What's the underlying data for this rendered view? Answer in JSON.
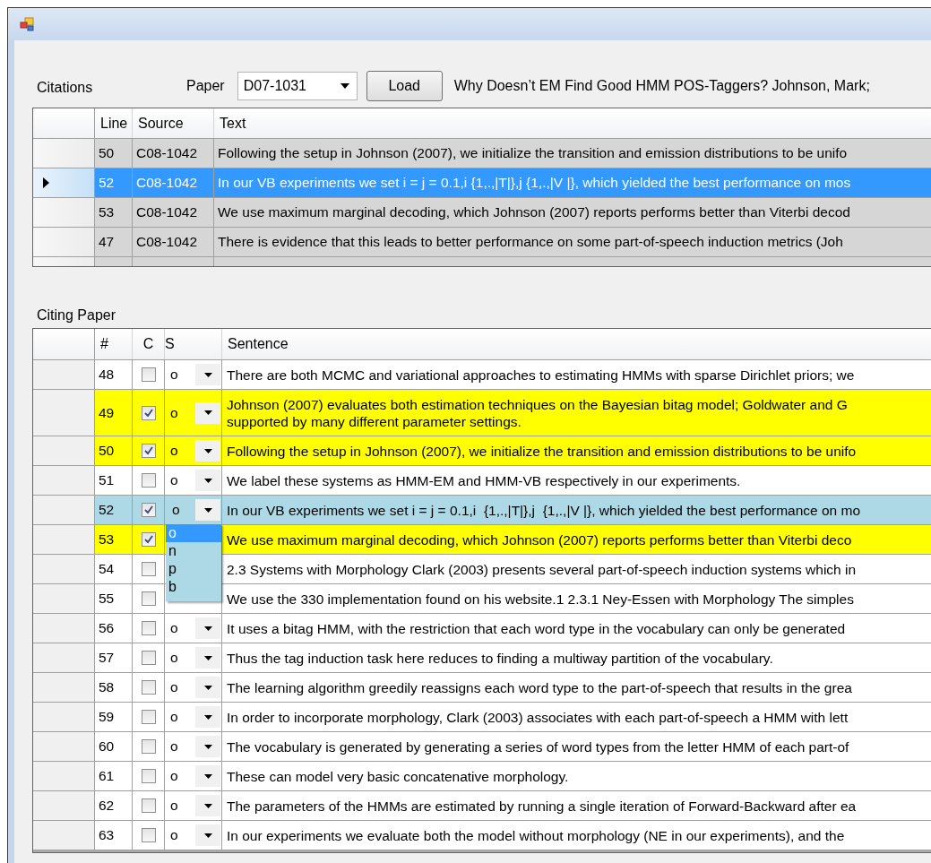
{
  "citations": {
    "label": "Citations",
    "paper_label": "Paper",
    "paper_value": "D07-1031",
    "load_button": "Load",
    "paper_title": "Why Doesn’t EM Find Good HMM POS-Taggers? Johnson, Mark;",
    "columns": [
      "Line",
      "Source",
      "Text"
    ],
    "rows": [
      {
        "line": "50",
        "source": "C08-1042",
        "text": "Following the setup in Johnson (2007), we initialize the transition and emission distributions to be unifo",
        "selected": false
      },
      {
        "line": "52",
        "source": "C08-1042",
        "text": "In our VB experiments we set i = j = 0.1,i  {1,.,|T|},j  {1,.,|V |}, which yielded the best performance on mos",
        "selected": true
      },
      {
        "line": "53",
        "source": "C08-1042",
        "text": "We use maximum marginal decoding, which Johnson (2007) reports performs better than Viterbi decod",
        "selected": false
      },
      {
        "line": "47",
        "source": "C08-1042",
        "text": "There is evidence that this leads to better performance on some part-of-speech induction metrics (Joh",
        "selected": false
      }
    ]
  },
  "citing_paper": {
    "label": "Citing Paper",
    "columns": [
      "#",
      "C",
      "S",
      "Sentence"
    ],
    "rows": [
      {
        "number": "48",
        "checked": false,
        "s": "o",
        "sentence": "There are both MCMC and variational approaches to estimating HMMs with sparse Dirichlet priors; we",
        "selected": false
      },
      {
        "number": "49",
        "checked": true,
        "s": "o",
        "sentence": "Johnson (2007) evaluates both estimation techniques on the Bayesian bitag model; Goldwater and G\nsupported by many different parameter settings.",
        "selected": false
      },
      {
        "number": "50",
        "checked": true,
        "s": "o",
        "sentence": "Following the setup in Johnson (2007), we initialize the transition and emission distributions to be unifo",
        "selected": false
      },
      {
        "number": "51",
        "checked": false,
        "s": "o",
        "sentence": "We label these systems as HMM-EM and HMM-VB respectively in our experiments.",
        "selected": false
      },
      {
        "number": "52",
        "checked": true,
        "s": "o",
        "sentence": "In our VB experiments we set i = j = 0.1,i  {1,.,|T|},j  {1,.,|V |}, which yielded the best performance on mo",
        "selected": true,
        "options": [
          {
            "label": "o",
            "selected": true
          },
          {
            "label": "n",
            "selected": false
          },
          {
            "label": "p",
            "selected": false
          },
          {
            "label": "b",
            "selected": false
          }
        ]
      },
      {
        "number": "53",
        "checked": true,
        "sentence": "We use maximum marginal decoding, which Johnson (2007) reports performs better than Viterbi deco",
        "selected": false
      },
      {
        "number": "54",
        "checked": false,
        "sentence": "2.3 Systems with Morphology Clark (2003) presents several part-of-speech induction systems which in",
        "selected": false
      },
      {
        "number": "55",
        "checked": false,
        "sentence": "We use the 330 implementation found on his website.1 2.3.1 Ney-Essen with Morphology The simples",
        "selected": false
      },
      {
        "number": "56",
        "checked": false,
        "s": "o",
        "sentence": "It uses a bitag HMM, with the restriction that each word type in the vocabulary can only be generated",
        "selected": false
      },
      {
        "number": "57",
        "checked": false,
        "s": "o",
        "sentence": "Thus the tag induction task here reduces to finding a multiway partition of the vocabulary.",
        "selected": false
      },
      {
        "number": "58",
        "checked": false,
        "s": "o",
        "sentence": "The learning algorithm greedily reassigns each word type to the part-of-speech that results in the grea",
        "selected": false
      },
      {
        "number": "59",
        "checked": false,
        "s": "o",
        "sentence": "In order to incorporate morphology, Clark (2003) associates with each part-of-speech a HMM with lett",
        "selected": false
      },
      {
        "number": "60",
        "checked": false,
        "s": "o",
        "sentence": "The vocabulary is generated by generating a series of word types from the letter HMM of each part-of",
        "selected": false
      },
      {
        "number": "61",
        "checked": false,
        "s": "o",
        "sentence": "These can model very basic concatenative morphology.",
        "selected": false
      },
      {
        "number": "62",
        "checked": false,
        "s": "o",
        "sentence": "The parameters of the HMMs are estimated by running a single iteration of Forward-Backward after ea",
        "selected": false
      },
      {
        "number": "63",
        "checked": false,
        "s": "o",
        "sentence": "In our experiments we evaluate both the model without morphology (NE in our experiments), and the",
        "selected": false
      }
    ]
  }
}
